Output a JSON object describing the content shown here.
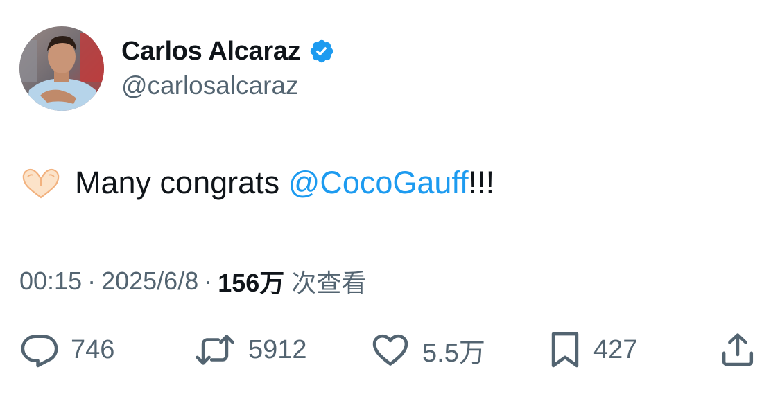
{
  "author": {
    "display_name": "Carlos Alcaraz",
    "handle": "@carlosalcaraz",
    "verified": true
  },
  "tweet": {
    "emoji": "heart-hands",
    "text_before": "Many congrats ",
    "mention": "@CocoGauff",
    "text_after": "!!!"
  },
  "meta": {
    "time": "00:15",
    "separator": "·",
    "date": "2025/6/8",
    "views_count": "156万",
    "views_label": "次查看"
  },
  "actions": {
    "replies": "746",
    "retweets": "5912",
    "likes": "5.5万",
    "bookmarks": "427"
  },
  "colors": {
    "accent": "#1d9bf0",
    "text": "#0f1419",
    "secondary": "#536471"
  }
}
